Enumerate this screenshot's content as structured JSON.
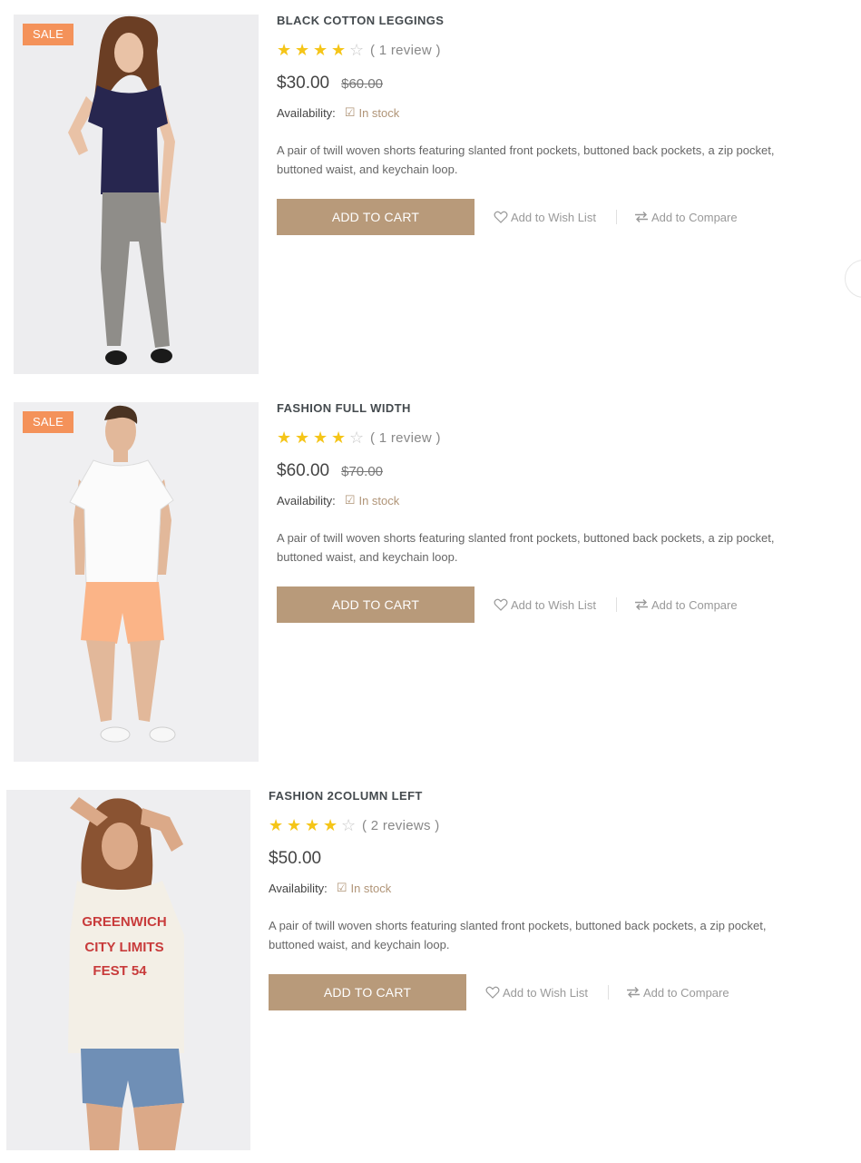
{
  "products": [
    {
      "badge": "SALE",
      "title": "BLACK COTTON LEGGINGS",
      "rating": 4,
      "review_text": "( 1  review )",
      "price": "$30.00",
      "old_price": "$60.00",
      "availability_label": "Availability:",
      "availability_value": "In stock",
      "description": "A pair of twill woven shorts featuring slanted front pockets, buttoned back pockets, a zip pocket, buttoned waist, and keychain loop.",
      "cart_label": "ADD TO CART",
      "wishlist_label": "Add to Wish List",
      "compare_label": "Add to Compare"
    },
    {
      "badge": "SALE",
      "title": "FASHION FULL WIDTH",
      "rating": 4,
      "review_text": "( 1  review )",
      "price": "$60.00",
      "old_price": "$70.00",
      "availability_label": "Availability:",
      "availability_value": "In stock",
      "description": "A pair of twill woven shorts featuring slanted front pockets, buttoned back pockets, a zip pocket, buttoned waist, and keychain loop.",
      "cart_label": "ADD TO CART",
      "wishlist_label": "Add to Wish List",
      "compare_label": "Add to Compare"
    },
    {
      "title": "FASHION 2COLUMN LEFT",
      "rating": 4,
      "review_text": "( 2  reviews )",
      "price": "$50.00",
      "availability_label": "Availability:",
      "availability_value": "In stock",
      "description": "A pair of twill woven shorts featuring slanted front pockets, buttoned back pockets, a zip pocket, buttoned waist, and keychain loop.",
      "cart_label": "ADD TO CART",
      "wishlist_label": "Add to Wish List",
      "compare_label": "Add to Compare",
      "shirt_print": [
        "GREENWICH",
        "CITY LIMITS",
        "FEST 54"
      ]
    }
  ],
  "colors": {
    "accent": "#b89a7a",
    "sale_badge": "#f4925a",
    "star": "#f5c518",
    "in_stock": "#b09477"
  },
  "icons": {
    "wishlist": "heart-icon",
    "compare": "compare-arrows-icon",
    "availability": "check-square-icon",
    "rating": "star-icon"
  }
}
